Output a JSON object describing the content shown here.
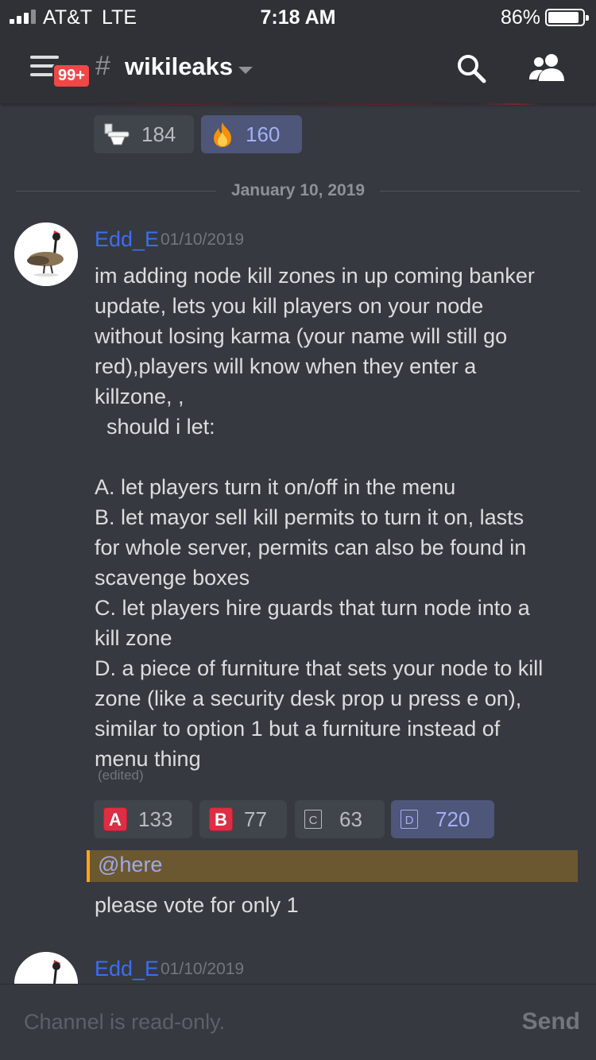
{
  "status_bar": {
    "carrier": "AT&T",
    "network": "LTE",
    "time": "7:18 AM",
    "battery": "86%",
    "battery_level": 0.86
  },
  "header": {
    "badge": "99+",
    "hash": "#",
    "channel": "wikileaks"
  },
  "top_reactions": [
    {
      "emoji": "toilet-icon",
      "count": "184"
    },
    {
      "emoji": "fire-icon",
      "count": "160"
    }
  ],
  "date_divider": "January 10, 2019",
  "message": {
    "author": "Edd_E",
    "timestamp": "01/10/2019",
    "text": "im adding node kill zones in up coming banker\nupdate, lets you kill players on your node\nwithout losing karma (your name will still go\nred),players will know when they enter a\nkillzone, ,\n  should i let:\n\nA. let players turn it on/off in the menu\nB. let mayor sell kill permits to turn it on, lasts\nfor whole server, permits can also be found in\nscavenge boxes\nC. let players hire guards that turn node into a\nkill zone\nD. a piece of furniture that sets your node to kill\nzone (like a security desk prop u press e on),\nsimilar to option 1 but a furniture instead of\nmenu thing",
    "edited": "(edited)",
    "reactions": [
      {
        "symbol": "A",
        "count": "133"
      },
      {
        "symbol": "B",
        "count": "77"
      },
      {
        "symbol": "C",
        "count": "63"
      },
      {
        "symbol": "D",
        "count": "720"
      }
    ],
    "mention": "@here",
    "followup": "please vote for only 1"
  },
  "next_message": {
    "author": "Edd_E",
    "timestamp": "01/10/2019"
  },
  "composer": {
    "placeholder": "Channel is read-only.",
    "send_label": "Send"
  }
}
